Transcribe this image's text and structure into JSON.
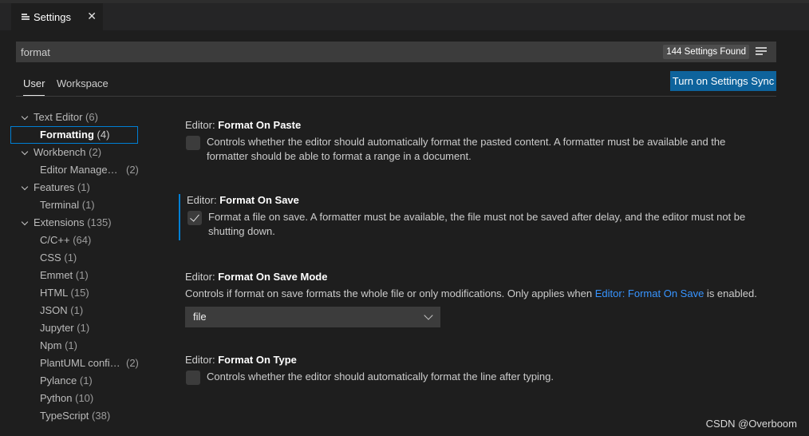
{
  "tab": {
    "title": "Settings",
    "icon": "settings-list-icon",
    "close": "✕"
  },
  "search": {
    "value": "format",
    "found": "144 Settings Found"
  },
  "scope_tabs": {
    "user": "User",
    "workspace": "Workspace"
  },
  "sync_button": "Turn on Settings Sync",
  "toc": {
    "text_editor": {
      "label": "Text Editor",
      "count": "(6)"
    },
    "formatting": {
      "label": "Formatting",
      "count": "(4)"
    },
    "workbench": {
      "label": "Workbench",
      "count": "(2)"
    },
    "editor_management": {
      "label": "Editor Manage…",
      "count": "(2)"
    },
    "features": {
      "label": "Features",
      "count": "(1)"
    },
    "terminal": {
      "label": "Terminal",
      "count": "(1)"
    },
    "extensions": {
      "label": "Extensions",
      "count": "(135)"
    },
    "cpp": {
      "label": "C/C++",
      "count": "(64)"
    },
    "css": {
      "label": "CSS",
      "count": "(1)"
    },
    "emmet": {
      "label": "Emmet",
      "count": "(1)"
    },
    "html": {
      "label": "HTML",
      "count": "(15)"
    },
    "json": {
      "label": "JSON",
      "count": "(1)"
    },
    "jupyter": {
      "label": "Jupyter",
      "count": "(1)"
    },
    "npm": {
      "label": "Npm",
      "count": "(1)"
    },
    "plantuml": {
      "label": "PlantUML confi…",
      "count": "(2)"
    },
    "pylance": {
      "label": "Pylance",
      "count": "(1)"
    },
    "python": {
      "label": "Python",
      "count": "(10)"
    },
    "typescript": {
      "label": "TypeScript",
      "count": "(38)"
    }
  },
  "settings": {
    "format_on_paste": {
      "category": "Editor: ",
      "key": "Format On Paste",
      "checked": false,
      "description": "Controls whether the editor should automatically format the pasted content. A formatter must be available and the formatter should be able to format a range in a document."
    },
    "format_on_save": {
      "category": "Editor: ",
      "key": "Format On Save",
      "checked": true,
      "description": "Format a file on save. A formatter must be available, the file must not be saved after delay, and the editor must not be shutting down."
    },
    "format_on_save_mode": {
      "category": "Editor: ",
      "key": "Format On Save Mode",
      "description_before": "Controls if format on save formats the whole file or only modifications. Only applies when ",
      "description_link": "Editor: Format On Save",
      "description_after": " is enabled.",
      "value": "file"
    },
    "format_on_type": {
      "category": "Editor: ",
      "key": "Format On Type",
      "checked": false,
      "description": "Controls whether the editor should automatically format the line after typing."
    }
  },
  "watermark": "CSDN @Overboom",
  "colors": {
    "accent": "#007fd4",
    "button": "#0e639c",
    "link": "#3794ff"
  }
}
